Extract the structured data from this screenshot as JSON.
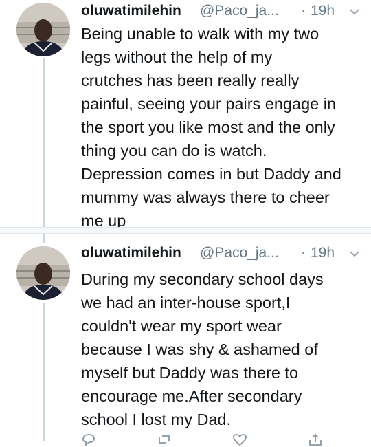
{
  "tweets": [
    {
      "name": "oluwatimilehin",
      "handle": "@Paco_ja...",
      "dot": "·",
      "time": "19h",
      "text": "Being unable to walk with my two\nlegs without the help of my\ncrutches has been really really\npainful, seeing your pairs engage in\nthe sport you like most and the only\nthing you can do is watch.\nDepression comes in but Daddy and\nmummy was always there to cheer\nme up"
    },
    {
      "name": "oluwatimilehin",
      "handle": "@Paco_ja...",
      "dot": "·",
      "time": "19h",
      "text": "During my secondary school days\nwe had an inter-house sport,I\ncouldn't wear my sport wear\nbecause I was shy & ashamed of\nmyself but Daddy was there to\nencourage me.After secondary\nschool I lost my Dad."
    }
  ],
  "icons": {
    "caret": "chevron-down-icon",
    "reply": "reply-icon",
    "retweet": "retweet-icon",
    "like": "heart-icon",
    "share": "share-icon"
  },
  "colors": {
    "text": "#14171a",
    "secondary": "#657786",
    "thread_line": "#ccd6dd",
    "separator": "#f5f8fa"
  }
}
